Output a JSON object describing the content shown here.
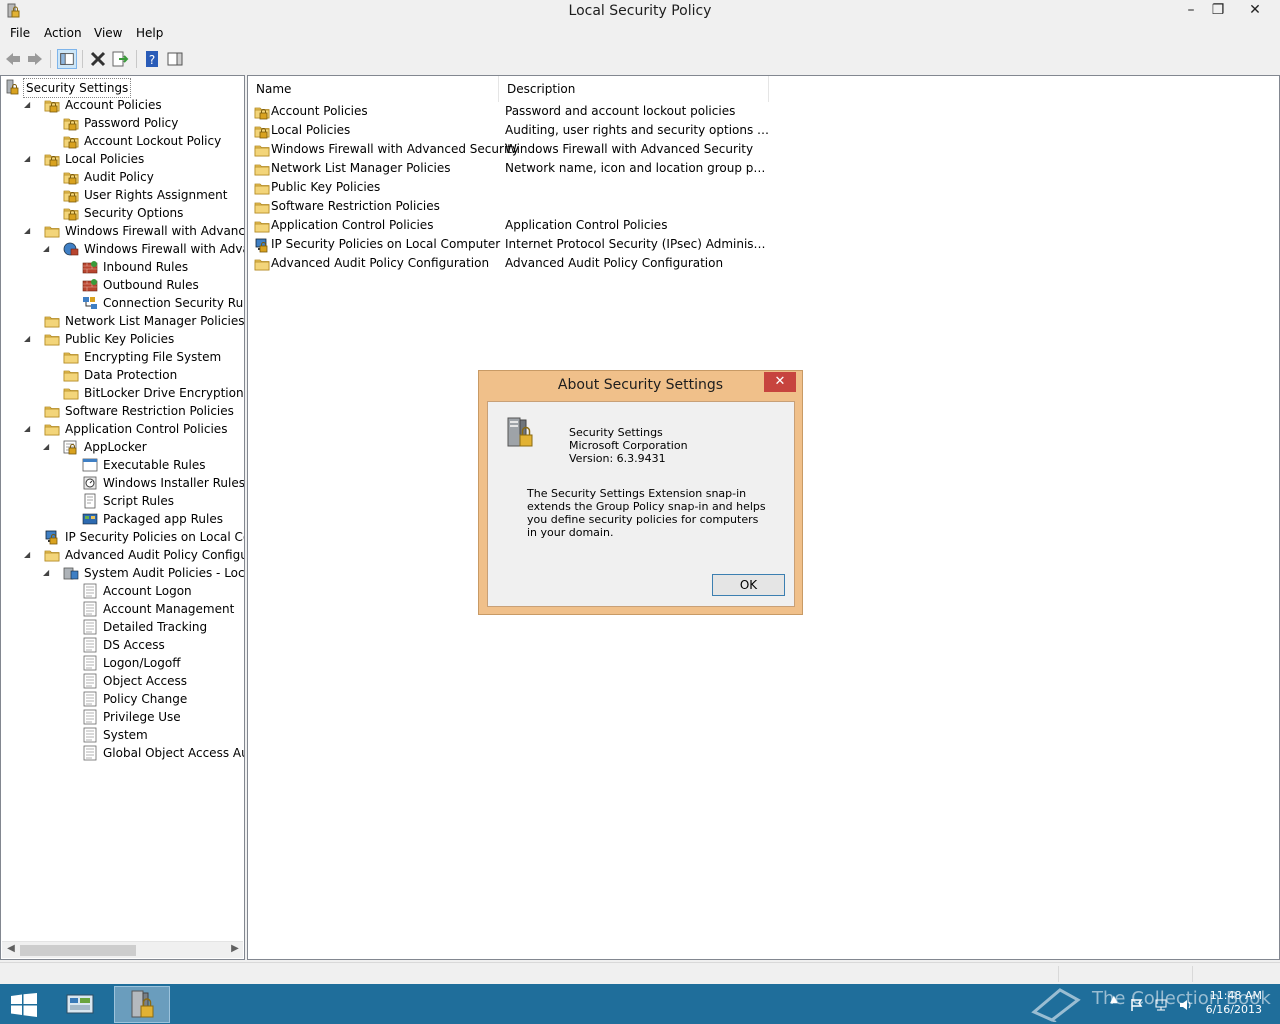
{
  "window": {
    "title": "Local Security Policy",
    "minimize": "–",
    "restore": "❐",
    "close": "✕"
  },
  "menu": {
    "items": [
      "File",
      "Action",
      "View",
      "Help"
    ]
  },
  "tree": {
    "items": [
      {
        "label": "Security Settings",
        "level": 0,
        "icon": "security-settings-icon",
        "expander": ""
      },
      {
        "label": "Account Policies",
        "level": 1,
        "icon": "locked-folder-icon",
        "expander": "◢"
      },
      {
        "label": "Password Policy",
        "level": 2,
        "icon": "locked-folder-icon",
        "expander": ""
      },
      {
        "label": "Account Lockout Policy",
        "level": 2,
        "icon": "locked-folder-icon",
        "expander": ""
      },
      {
        "label": "Local Policies",
        "level": 1,
        "icon": "locked-folder-icon",
        "expander": "◢"
      },
      {
        "label": "Audit Policy",
        "level": 2,
        "icon": "locked-folder-icon",
        "expander": ""
      },
      {
        "label": "User Rights Assignment",
        "level": 2,
        "icon": "locked-folder-icon",
        "expander": ""
      },
      {
        "label": "Security Options",
        "level": 2,
        "icon": "locked-folder-icon",
        "expander": ""
      },
      {
        "label": "Windows Firewall with Advanced Secu",
        "level": 1,
        "icon": "folder-icon",
        "expander": "◢"
      },
      {
        "label": "Windows Firewall with Advanced",
        "level": 2,
        "icon": "firewall-icon",
        "expander": "◢"
      },
      {
        "label": "Inbound Rules",
        "level": 3,
        "icon": "inbound-rules-icon",
        "expander": ""
      },
      {
        "label": "Outbound Rules",
        "level": 3,
        "icon": "outbound-rules-icon",
        "expander": ""
      },
      {
        "label": "Connection Security Rules",
        "level": 3,
        "icon": "connection-security-icon",
        "expander": ""
      },
      {
        "label": "Network List Manager Policies",
        "level": 1,
        "icon": "folder-icon",
        "expander": ""
      },
      {
        "label": "Public Key Policies",
        "level": 1,
        "icon": "folder-icon",
        "expander": "◢"
      },
      {
        "label": "Encrypting File System",
        "level": 2,
        "icon": "folder-icon",
        "expander": ""
      },
      {
        "label": "Data Protection",
        "level": 2,
        "icon": "folder-icon",
        "expander": ""
      },
      {
        "label": "BitLocker Drive Encryption",
        "level": 2,
        "icon": "folder-icon",
        "expander": ""
      },
      {
        "label": "Software Restriction Policies",
        "level": 1,
        "icon": "folder-icon",
        "expander": ""
      },
      {
        "label": "Application Control Policies",
        "level": 1,
        "icon": "folder-icon",
        "expander": "◢"
      },
      {
        "label": "AppLocker",
        "level": 2,
        "icon": "applocker-icon",
        "expander": "◢"
      },
      {
        "label": "Executable Rules",
        "level": 3,
        "icon": "executable-rules-icon",
        "expander": ""
      },
      {
        "label": "Windows Installer Rules",
        "level": 3,
        "icon": "installer-rules-icon",
        "expander": ""
      },
      {
        "label": "Script Rules",
        "level": 3,
        "icon": "script-rules-icon",
        "expander": ""
      },
      {
        "label": "Packaged app Rules",
        "level": 3,
        "icon": "packaged-app-icon",
        "expander": ""
      },
      {
        "label": "IP Security Policies on Local Compute",
        "level": 1,
        "icon": "ip-security-icon",
        "expander": ""
      },
      {
        "label": "Advanced Audit Policy Configuration",
        "level": 1,
        "icon": "folder-icon",
        "expander": "◢"
      },
      {
        "label": "System Audit Policies - Local Grou",
        "level": 2,
        "icon": "audit-policies-icon",
        "expander": "◢"
      },
      {
        "label": "Account Logon",
        "level": 3,
        "icon": "audit-category-icon",
        "expander": ""
      },
      {
        "label": "Account Management",
        "level": 3,
        "icon": "audit-category-icon",
        "expander": ""
      },
      {
        "label": "Detailed Tracking",
        "level": 3,
        "icon": "audit-category-icon",
        "expander": ""
      },
      {
        "label": "DS Access",
        "level": 3,
        "icon": "audit-category-icon",
        "expander": ""
      },
      {
        "label": "Logon/Logoff",
        "level": 3,
        "icon": "audit-category-icon",
        "expander": ""
      },
      {
        "label": "Object Access",
        "level": 3,
        "icon": "audit-category-icon",
        "expander": ""
      },
      {
        "label": "Policy Change",
        "level": 3,
        "icon": "audit-category-icon",
        "expander": ""
      },
      {
        "label": "Privilege Use",
        "level": 3,
        "icon": "audit-category-icon",
        "expander": ""
      },
      {
        "label": "System",
        "level": 3,
        "icon": "audit-category-icon",
        "expander": ""
      },
      {
        "label": "Global Object Access Auditing",
        "level": 3,
        "icon": "audit-category-icon",
        "expander": ""
      }
    ]
  },
  "list": {
    "columns": [
      "Name",
      "Description"
    ],
    "rows": [
      {
        "name": "Account Policies",
        "description": "Password and account lockout policies",
        "icon": "locked-folder-icon"
      },
      {
        "name": "Local Policies",
        "description": "Auditing, user rights and security options polici...",
        "icon": "locked-folder-icon"
      },
      {
        "name": "Windows Firewall with Advanced Security",
        "description": "Windows Firewall with Advanced Security",
        "icon": "folder-icon"
      },
      {
        "name": "Network List Manager Policies",
        "description": "Network name, icon and location group policies.",
        "icon": "folder-icon"
      },
      {
        "name": "Public Key Policies",
        "description": "",
        "icon": "folder-icon"
      },
      {
        "name": "Software Restriction Policies",
        "description": "",
        "icon": "folder-icon"
      },
      {
        "name": "Application Control Policies",
        "description": "Application Control Policies",
        "icon": "folder-icon"
      },
      {
        "name": "IP Security Policies on Local Computer",
        "description": "Internet Protocol Security (IPsec) Administratio...",
        "icon": "ip-security-icon"
      },
      {
        "name": "Advanced Audit Policy Configuration",
        "description": "Advanced Audit Policy Configuration",
        "icon": "folder-icon"
      }
    ]
  },
  "dialog": {
    "title": "About Security Settings",
    "close": "✕",
    "product": "Security Settings",
    "company": "Microsoft Corporation",
    "version": "Version: 6.3.9431",
    "description": "The Security Settings Extension snap-in extends the Group Policy snap-in and helps you define security policies for computers in your domain.",
    "ok": "OK"
  },
  "taskbar": {
    "watermark": "The Collection Book",
    "time": "11:48 AM",
    "date": "6/16/2013"
  },
  "colors": {
    "taskbar": "#1f6e9b",
    "dialog_frame": "#f0c08a",
    "dialog_close": "#c7443e",
    "folder": "#e8c25a"
  }
}
